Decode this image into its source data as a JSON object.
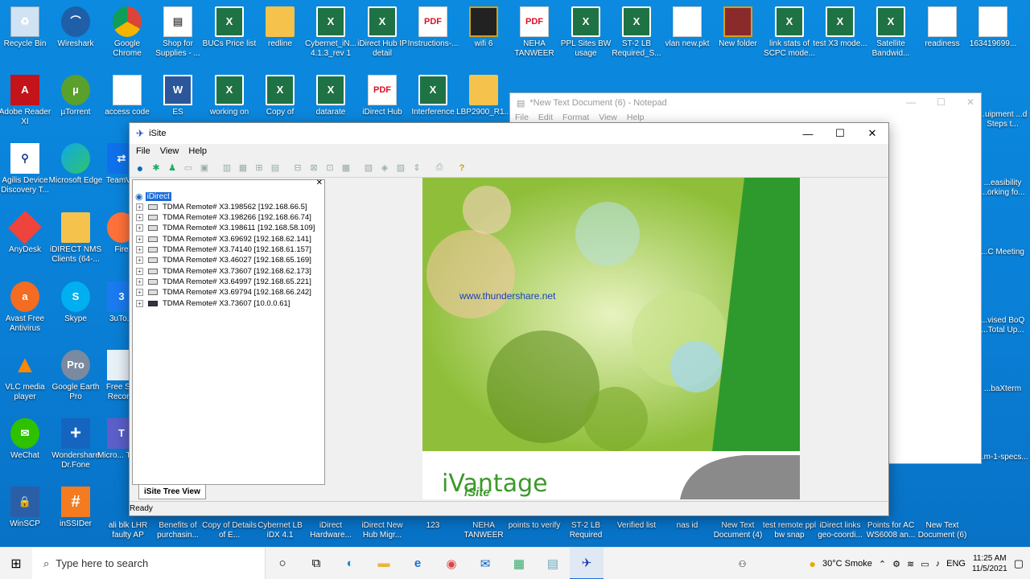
{
  "desktop": {
    "row1": [
      "Recycle Bin",
      "Wireshark",
      "Google Chrome",
      "Shop for Supplies - ...",
      "BUCs Price list",
      "redline",
      "Cybernet_iN... 4.1.3_rev 1",
      "iDirect Hub IP detail",
      "Instructions-...",
      "wifi 6",
      "NEHA TANWEER",
      "PPL Sites BW usage",
      "ST-2 LB Required_S...",
      "vlan new.pkt",
      "New folder",
      "link stats of SCPC mode...",
      "test X3 mode...",
      "Satellite Bandwid...",
      "readiness",
      "163419699..."
    ],
    "row2": [
      "Adobe Reader XI",
      "µTorrent",
      "access code",
      "ES",
      "working on",
      "Copy of",
      "datarate",
      "iDirect Hub",
      "Interference",
      "LBP2900_R1..."
    ],
    "col1": [
      "Agilis Device Discovery T...",
      "AnyDesk",
      "Avast Free Antivirus",
      "VLC media player",
      "WeChat",
      "WinSCP"
    ],
    "col2": [
      "Microsoft Edge",
      "iDIRECT NMS Clients (64-...",
      "Skype",
      "Google Earth Pro",
      "Wondershare Dr.Fone",
      "inSSIDer"
    ],
    "col3": [
      "TeamV...",
      "Fire",
      "3uTo...",
      "Free S... Recor...",
      "Micro... Tea...",
      "ali blk LHR faulty AP"
    ],
    "bottom": [
      "Benefits of purchasin...",
      "Copy of Details of E...",
      "Cybernet LB iDX 4.1",
      "iDirect Hardware...",
      "iDirect New Hub Migr...",
      "123",
      "NEHA TANWEER",
      "points to verify",
      "ST-2 LB Required",
      "Verified list",
      "nas id",
      "New Text Document (4)",
      "test remote ppl bw snap",
      "iDirect links geo-coordi...",
      "Points for AC WS6008 an...",
      "New Text Document (6)"
    ],
    "right": [
      "...uipment ...d Steps t...",
      "...easibility ...orking fo...",
      "...C Meeting",
      "...vised BoQ ...Total Up...",
      "...baXterm",
      "...m-1-specs..."
    ]
  },
  "notepad": {
    "title": "*New Text Document (6) - Notepad",
    "menu": [
      "File",
      "Edit",
      "Format",
      "View",
      "Help"
    ]
  },
  "isite": {
    "title": "iSite",
    "menu": [
      "File",
      "View",
      "Help"
    ],
    "root": "iDirect",
    "remotes": [
      "TDMA Remote# X3.198562 [192.168.66.5]",
      "TDMA Remote# X3.198266 [192.168.66.74]",
      "TDMA Remote# X3.198611 [192.168.58.109]",
      "TDMA Remote# X3.69692 [192.168.62.141]",
      "TDMA Remote# X3.74140 [192.168.61.157]",
      "TDMA Remote# X3.46027 [192.168.65.169]",
      "TDMA Remote# X3.73607 [192.168.62.173]",
      "TDMA Remote# X3.64997 [192.168.65.221]",
      "TDMA Remote# X3.69794 [192.168.66.242]",
      "TDMA Remote# X3.73607 [10.0.0.61]"
    ],
    "tab": "iSite Tree View",
    "status": "Ready",
    "watermark": "www.thundershare.net",
    "brand": "iVantage",
    "brand_sub": "iSite"
  },
  "taskbar": {
    "search_placeholder": "Type here to search",
    "weather": "30°C Smoke",
    "lang": "ENG",
    "time": "11:25 AM",
    "date": "11/5/2021"
  }
}
